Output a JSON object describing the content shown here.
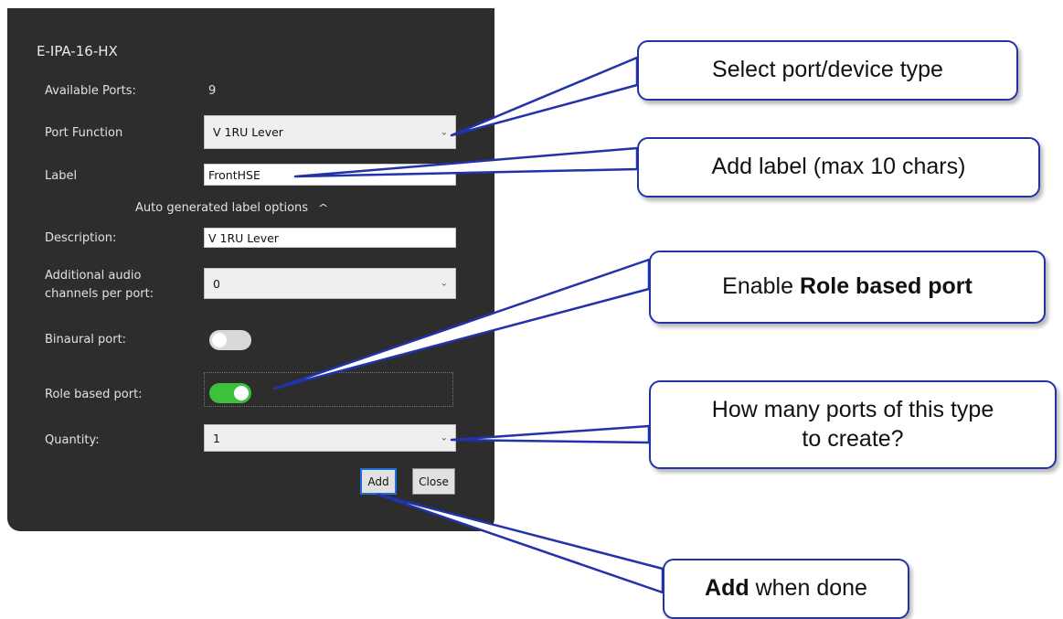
{
  "dialog": {
    "device_name": "E-IPA-16-HX",
    "available_ports_label": "Available Ports:",
    "available_ports_value": "9",
    "port_function_label": "Port Function",
    "port_function_value": "V 1RU Lever",
    "label_label": "Label",
    "label_value": "FrontHSE",
    "auto_label_options": "Auto generated label options",
    "description_label": "Description:",
    "description_value": "V 1RU Lever",
    "additional_audio_label_line1": "Additional audio",
    "additional_audio_label_line2": "channels per port:",
    "additional_audio_value": "0",
    "binaural_label": "Binaural port:",
    "binaural_on": false,
    "role_based_label": "Role based port:",
    "role_based_on": true,
    "quantity_label": "Quantity:",
    "quantity_value": "1",
    "add_button": "Add",
    "close_button": "Close"
  },
  "callouts": {
    "select_type": "Select port/device type",
    "add_label": "Add label (max 10 chars)",
    "enable_role_prefix": "Enable ",
    "enable_role_bold": "Role based port",
    "how_many_line1": "How many ports of this type",
    "how_many_line2": "to create?",
    "add_done_bold": "Add",
    "add_done_suffix": " when done"
  },
  "colors": {
    "panel_bg": "#2d2d2d",
    "toggle_on": "#3cc13c",
    "toggle_off": "#d9d9d9",
    "callout_border": "#2233aa"
  }
}
